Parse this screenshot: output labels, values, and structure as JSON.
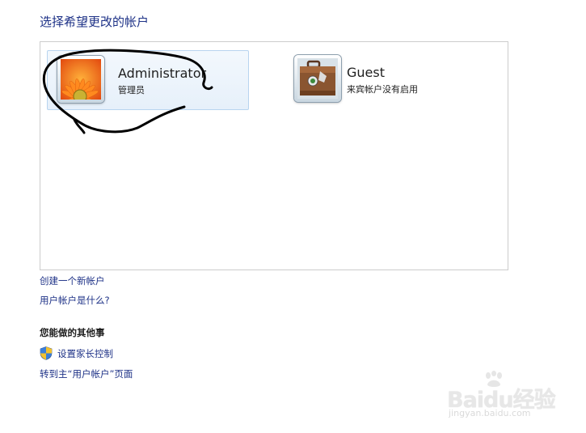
{
  "header": {
    "title": "选择希望更改的帐户"
  },
  "accounts": [
    {
      "name": "Administrator",
      "subtitle": "管理员",
      "avatar": "flower-avatar-icon",
      "selected": true
    },
    {
      "name": "Guest",
      "subtitle": "来宾帐户没有启用",
      "avatar": "suitcase-avatar-icon",
      "selected": false
    }
  ],
  "links": {
    "create_account": "创建一个新帐户",
    "what_is_account": "用户帐户是什么?"
  },
  "other_tasks": {
    "heading": "您能做的其他事",
    "parental_controls": "设置家长控制",
    "goto_main": "转到主“用户帐户”页面"
  },
  "watermark": {
    "brand": "Baidu经验",
    "site": "jingyan.baidu.com"
  },
  "colors": {
    "link": "#1e3287",
    "selection_border": "#b8d4ef",
    "panel_border": "#cccccc"
  }
}
